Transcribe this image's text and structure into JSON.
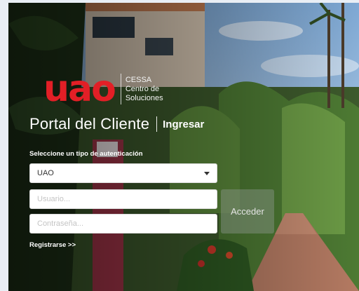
{
  "logo": {
    "brand": "uao",
    "subtitle_line1": "CESSA",
    "subtitle_line2": "Centro de",
    "subtitle_line3": "Soluciones"
  },
  "header": {
    "portal_title": "Portal del Cliente",
    "ingresar": "Ingresar"
  },
  "form": {
    "auth_label": "Seleccione un tipo de autenticación",
    "auth_selected": "UAO",
    "username_placeholder": "Usuario...",
    "password_placeholder": "Contraseña...",
    "submit_label": "Acceder",
    "register_link": "Registrarse >>"
  },
  "colors": {
    "brand_red": "#e21f26",
    "button_bg": "#8c968c"
  }
}
